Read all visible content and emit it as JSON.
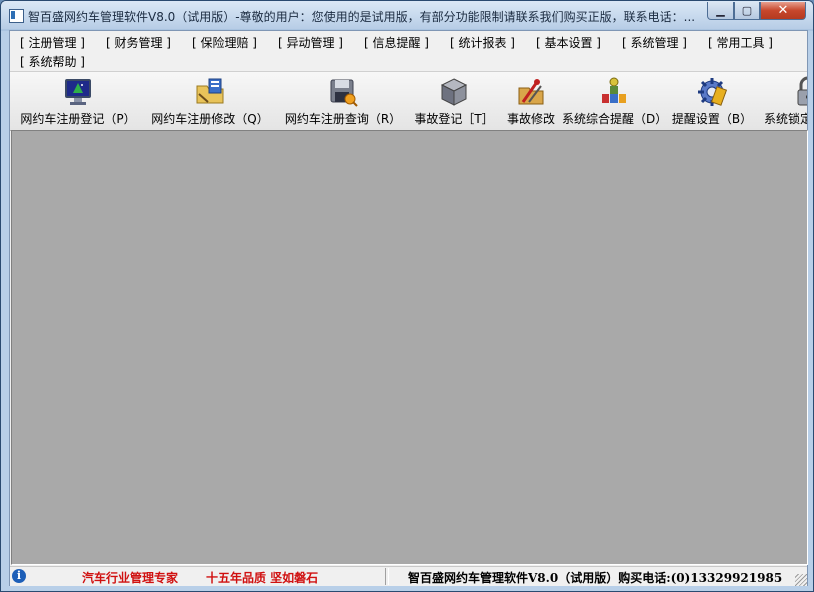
{
  "window": {
    "title": "智百盛网约车管理软件V8.0（试用版）-尊敬的用户：您使用的是试用版，有部分功能限制请联系我们购买正版，联系电话：...",
    "min_label": "▁",
    "max_label": "▢",
    "close_label": "✕"
  },
  "menu": [
    {
      "label": "[ 注册管理 ]"
    },
    {
      "label": "[ 财务管理 ]"
    },
    {
      "label": "[ 保险理赔 ]"
    },
    {
      "label": "[ 异动管理 ]"
    },
    {
      "label": "[ 信息提醒 ]"
    },
    {
      "label": "[ 统计报表 ]"
    },
    {
      "label": "[ 基本设置 ]"
    },
    {
      "label": "[ 系统管理 ]"
    },
    {
      "label": "[ 常用工具 ]"
    },
    {
      "label": "[ 系统帮助 ]"
    }
  ],
  "toolbar": [
    {
      "label": "网约车注册登记（P）",
      "icon": "monitor-icon"
    },
    {
      "label": "网约车注册修改（Q）",
      "icon": "folder-edit-icon"
    },
    {
      "label": "网约车注册查询（R）",
      "icon": "disk-search-icon"
    },
    {
      "label": "事故登记［T］",
      "icon": "cube-icon"
    },
    {
      "label": "事故修改",
      "icon": "tools-icon"
    },
    {
      "label": "系统综合提醒（D）",
      "icon": "tray-icon"
    },
    {
      "label": "提醒设置（B）",
      "icon": "gear-icon"
    },
    {
      "label": "系统锁定",
      "icon": "lock-icon"
    }
  ],
  "status": {
    "slogan1": "汽车行业管理专家",
    "slogan2": "十五年品质 坚如磐石",
    "product": "智百盛网约车管理软件V8.0（试用版）购买电话:(0)13329921985"
  },
  "colors": {
    "workspace": "#a9a9a9",
    "slogan": "#d01010",
    "close_button": "#c7472c"
  }
}
